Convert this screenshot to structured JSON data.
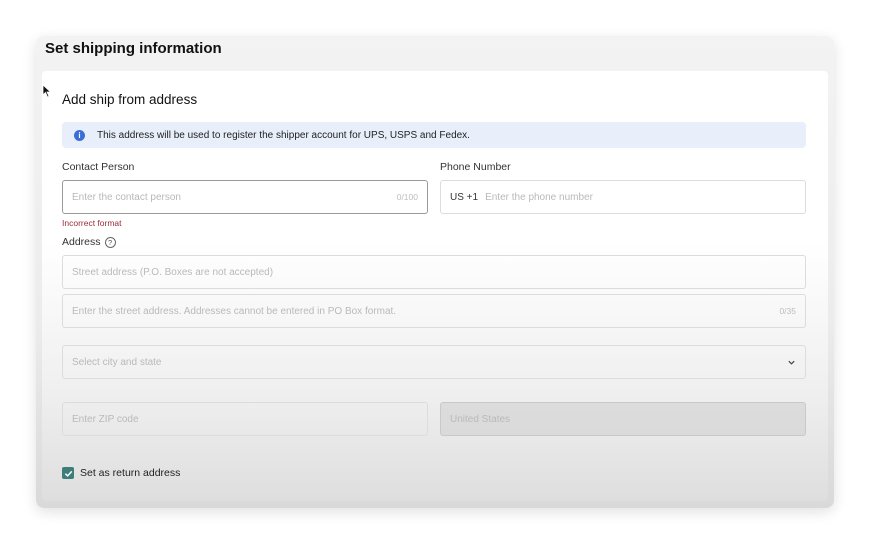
{
  "modal": {
    "title": "Set shipping information"
  },
  "section": {
    "title": "Add ship from address"
  },
  "banner": {
    "text": "This address will be used to register the shipper account for UPS, USPS and Fedex."
  },
  "contact": {
    "label": "Contact Person",
    "placeholder": "Enter the contact person",
    "counter": "0/100",
    "error": "Incorrect format"
  },
  "phone": {
    "label": "Phone Number",
    "prefix": "US +1",
    "placeholder": "Enter the phone number"
  },
  "address": {
    "label": "Address",
    "street_placeholder": "Street address (P.O. Boxes are not accepted)",
    "street2_placeholder": "Enter the street address. Addresses cannot be entered in PO Box format.",
    "street2_counter": "0/35",
    "city_placeholder": "Select city and state",
    "zip_placeholder": "Enter ZIP code",
    "country": "United States"
  },
  "return_address": {
    "label": "Set as return address",
    "checked": true
  },
  "colors": {
    "accent": "#3e7e7a",
    "info": "#3a6fd8",
    "banner_bg": "#e8effa",
    "error": "#9a2b3a"
  }
}
